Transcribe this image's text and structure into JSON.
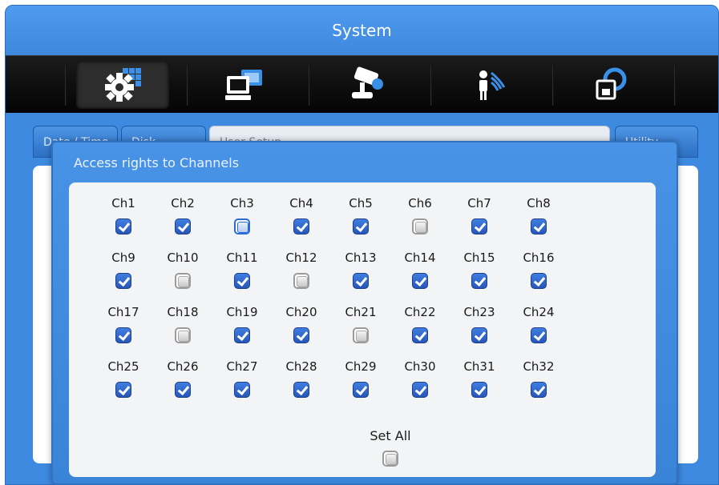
{
  "window": {
    "title": "System"
  },
  "toolbar": {
    "icons": [
      "gear-grid-icon",
      "computer-network-icon",
      "ptz-camera-icon",
      "motion-person-icon",
      "backup-disk-icon"
    ]
  },
  "tabs": [
    {
      "label": "Date / Time"
    },
    {
      "label": "Disk"
    },
    {
      "label": "User Setup"
    },
    {
      "label": "Utility"
    }
  ],
  "dialog": {
    "title": "Access rights to Channels",
    "channels": [
      {
        "label": "Ch1",
        "state": "checked"
      },
      {
        "label": "Ch2",
        "state": "checked"
      },
      {
        "label": "Ch3",
        "state": "focused"
      },
      {
        "label": "Ch4",
        "state": "checked"
      },
      {
        "label": "Ch5",
        "state": "checked"
      },
      {
        "label": "Ch6",
        "state": "unchecked"
      },
      {
        "label": "Ch7",
        "state": "checked"
      },
      {
        "label": "Ch8",
        "state": "checked"
      },
      {
        "label": "Ch9",
        "state": "checked"
      },
      {
        "label": "Ch10",
        "state": "unchecked"
      },
      {
        "label": "Ch11",
        "state": "checked"
      },
      {
        "label": "Ch12",
        "state": "unchecked"
      },
      {
        "label": "Ch13",
        "state": "checked"
      },
      {
        "label": "Ch14",
        "state": "checked"
      },
      {
        "label": "Ch15",
        "state": "checked"
      },
      {
        "label": "Ch16",
        "state": "checked"
      },
      {
        "label": "Ch17",
        "state": "checked"
      },
      {
        "label": "Ch18",
        "state": "unchecked"
      },
      {
        "label": "Ch19",
        "state": "checked"
      },
      {
        "label": "Ch20",
        "state": "checked"
      },
      {
        "label": "Ch21",
        "state": "unchecked"
      },
      {
        "label": "Ch22",
        "state": "checked"
      },
      {
        "label": "Ch23",
        "state": "checked"
      },
      {
        "label": "Ch24",
        "state": "checked"
      },
      {
        "label": "Ch25",
        "state": "checked"
      },
      {
        "label": "Ch26",
        "state": "checked"
      },
      {
        "label": "Ch27",
        "state": "checked"
      },
      {
        "label": "Ch28",
        "state": "checked"
      },
      {
        "label": "Ch29",
        "state": "checked"
      },
      {
        "label": "Ch30",
        "state": "checked"
      },
      {
        "label": "Ch31",
        "state": "checked"
      },
      {
        "label": "Ch32",
        "state": "checked"
      }
    ],
    "set_all": {
      "label": "Set All",
      "state": "unchecked"
    }
  }
}
